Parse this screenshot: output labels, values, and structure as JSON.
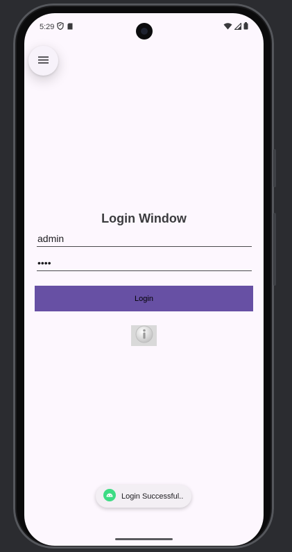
{
  "status_bar": {
    "time": "5:29",
    "left_icons": [
      "shield-icon",
      "sim-card-icon"
    ],
    "right_icons": [
      "wifi-icon",
      "signal-icon",
      "battery-icon"
    ]
  },
  "menu": {
    "icon": "hamburger-menu-icon"
  },
  "login": {
    "title": "Login Window",
    "username_value": "admin",
    "password_value": "1234",
    "button_label": "Login"
  },
  "image": {
    "icon": "info-icon"
  },
  "toast": {
    "icon": "android-icon",
    "message": "Login Successful.."
  },
  "colors": {
    "background": "#fdf7fe",
    "primary_button": "#6750a4",
    "toast_icon": "#3ddc84"
  }
}
